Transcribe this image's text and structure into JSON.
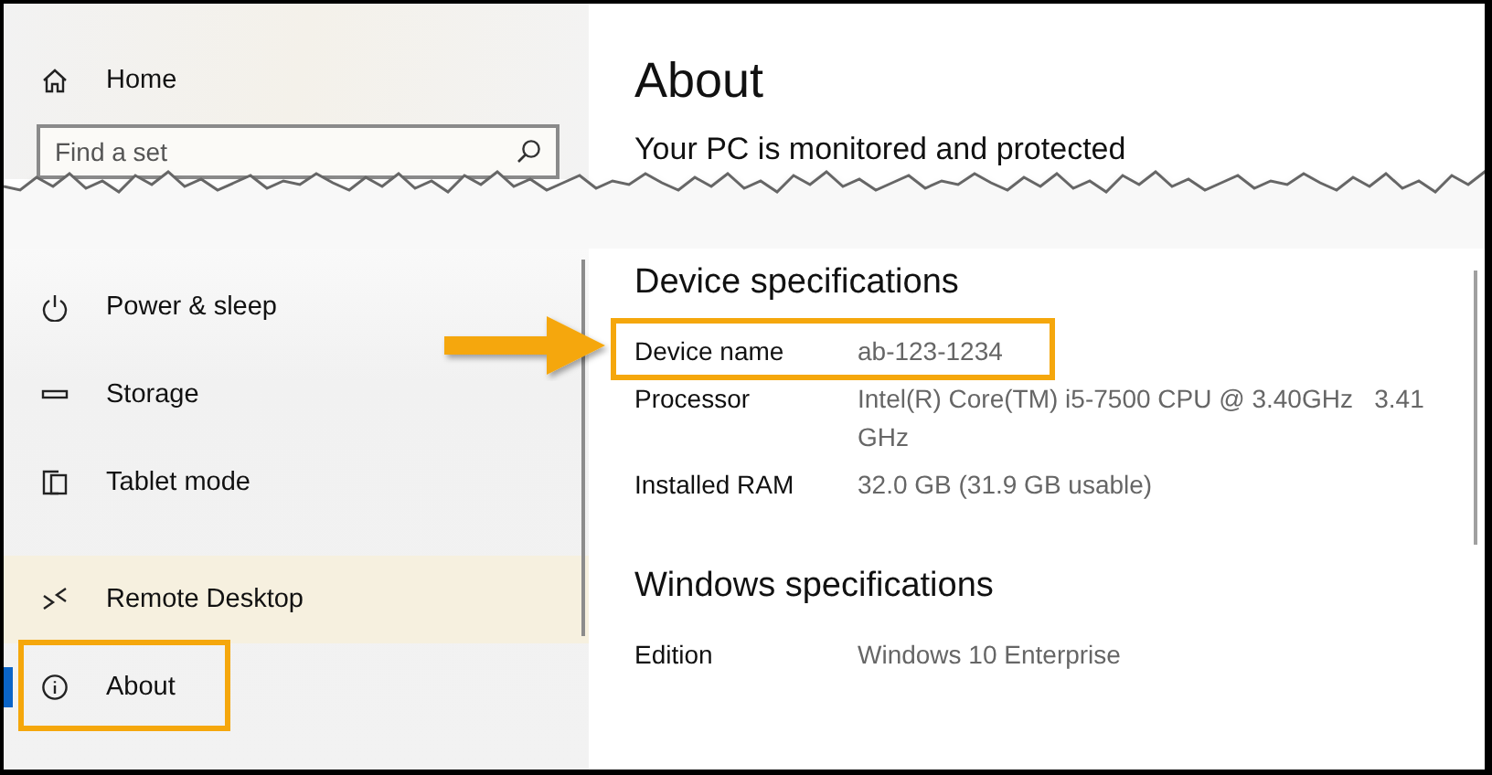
{
  "sidebar": {
    "items": [
      {
        "label": "Home",
        "selected": false
      },
      {
        "label": "Power & sleep",
        "selected": false
      },
      {
        "label": "Storage",
        "selected": false
      },
      {
        "label": "Tablet mode",
        "selected": false
      },
      {
        "label": "Remote Desktop",
        "selected": false
      },
      {
        "label": "About",
        "selected": true
      }
    ],
    "search": {
      "placeholder": "Find a set"
    }
  },
  "page": {
    "title": "About",
    "status": "Your PC is monitored and protected",
    "sections": [
      {
        "heading": "Device specifications",
        "rows": [
          {
            "label": "Device name",
            "value": "ab-123-1234",
            "highlighted": true
          },
          {
            "label": "Processor",
            "value": "Intel(R) Core(TM) i5-7500 CPU @ 3.40GHz   3.41 GHz",
            "highlighted": false
          },
          {
            "label": "Installed RAM",
            "value": "32.0 GB (31.9 GB usable)",
            "highlighted": false
          }
        ]
      },
      {
        "heading": "Windows specifications",
        "rows": [
          {
            "label": "Edition",
            "value": "Windows 10 Enterprise",
            "highlighted": false
          }
        ]
      }
    ]
  }
}
